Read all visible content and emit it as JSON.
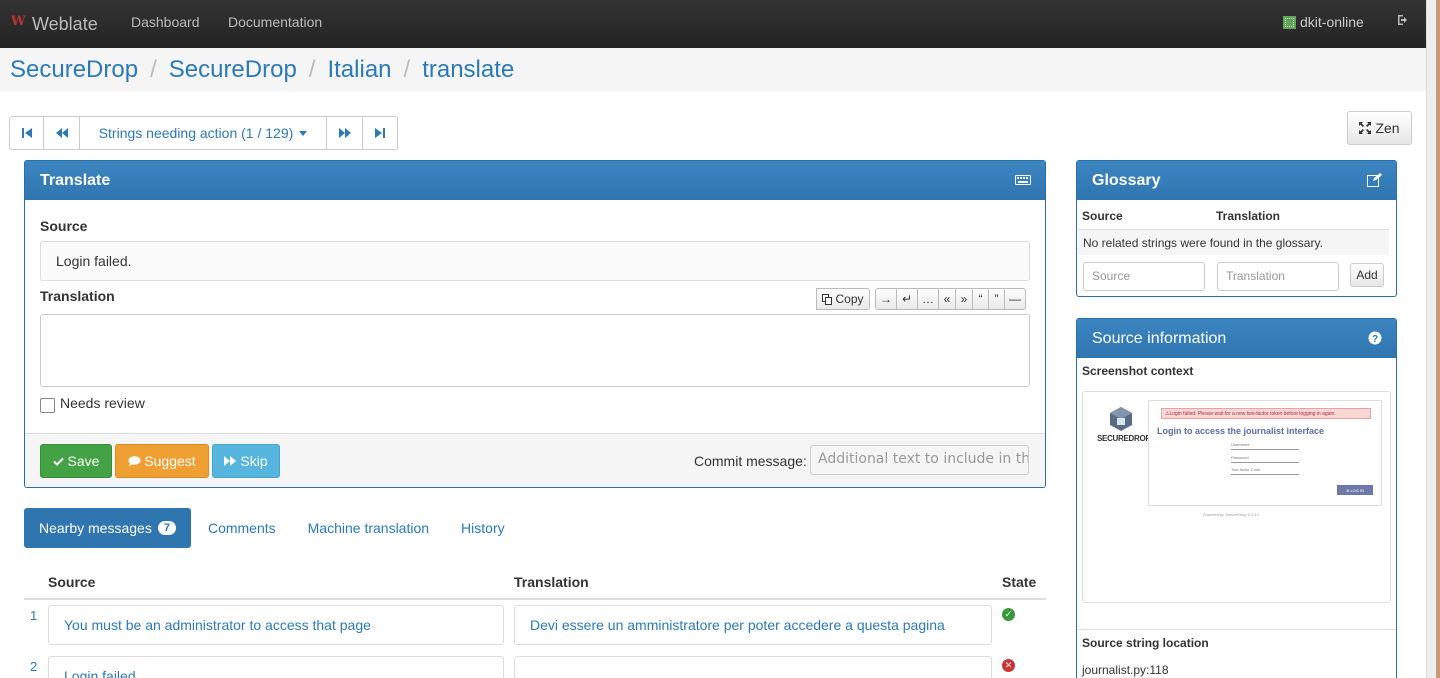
{
  "navbar": {
    "brand": "Weblate",
    "links": [
      "Dashboard",
      "Documentation"
    ],
    "user": "dkit-online"
  },
  "breadcrumb": [
    "SecureDrop",
    "SecureDrop",
    "Italian",
    "translate"
  ],
  "navigation": {
    "filter_label": "Strings needing action (1 / 129)",
    "zen_label": "Zen"
  },
  "translate_panel": {
    "title": "Translate",
    "source_label": "Source",
    "source_text": "Login failed.",
    "translation_label": "Translation",
    "translation_value": "",
    "copy_label": "Copy",
    "special_chars": [
      "→",
      "↵",
      "…",
      "«",
      "»",
      "“",
      "”",
      "—"
    ],
    "needs_review_label": "Needs review",
    "needs_review_checked": false,
    "save_label": "Save",
    "suggest_label": "Suggest",
    "skip_label": "Skip",
    "commit_label": "Commit message:",
    "commit_placeholder": "Additional text to include in the"
  },
  "tabs": {
    "nearby_label": "Nearby messages",
    "nearby_count": "7",
    "comments_label": "Comments",
    "machine_label": "Machine translation",
    "history_label": "History"
  },
  "nearby": {
    "headers": [
      "Source",
      "Translation",
      "State"
    ],
    "rows": [
      {
        "num": "1",
        "source": "You must be an administrator to access that page",
        "translation": "Devi essere un amministratore per poter accedere a questa pagina",
        "state": "translated"
      },
      {
        "num": "2",
        "source": "Login failed.",
        "translation": "",
        "state": "untranslated"
      }
    ]
  },
  "glossary": {
    "title": "Glossary",
    "col_source": "Source",
    "col_translation": "Translation",
    "empty_text": "No related strings were found in the glossary.",
    "source_placeholder": "Source",
    "translation_placeholder": "Translation",
    "add_label": "Add"
  },
  "source_info": {
    "title": "Source information",
    "screenshot_label": "Screenshot context",
    "screenshot": {
      "alert": "⚠Login failed. Please wait for a new two-factor token before logging in again.",
      "heading": "Login to access the journalist interface",
      "logo_text": "SECUREDROP",
      "field_username": "Username",
      "field_password": "Password",
      "field_code": "Two-factor Code",
      "button": "⊛ LOG IN",
      "powered": "Powered by SecureDrop 0.3.12"
    },
    "location_label": "Source string location",
    "location_value": "journalist.py:118"
  }
}
